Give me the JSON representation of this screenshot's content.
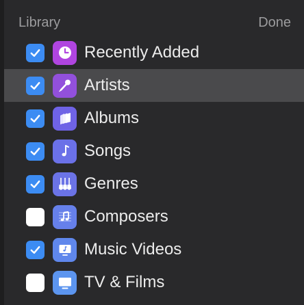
{
  "header": {
    "title": "Library",
    "done_label": "Done"
  },
  "items": [
    {
      "label": "Recently Added",
      "checked": true,
      "icon": "clock-icon",
      "color": "#b045e0"
    },
    {
      "label": "Artists",
      "checked": true,
      "icon": "microphone-icon",
      "color": "#9250dc"
    },
    {
      "label": "Albums",
      "checked": true,
      "icon": "albums-icon",
      "color": "#6f63e6"
    },
    {
      "label": "Songs",
      "checked": true,
      "icon": "music-note-icon",
      "color": "#6b71e8"
    },
    {
      "label": "Genres",
      "checked": true,
      "icon": "guitars-icon",
      "color": "#6b73e6"
    },
    {
      "label": "Composers",
      "checked": false,
      "icon": "sheet-music-icon",
      "color": "#6680ea"
    },
    {
      "label": "Music Videos",
      "checked": true,
      "icon": "music-video-icon",
      "color": "#5f87ec"
    },
    {
      "label": "TV & Films",
      "checked": false,
      "icon": "tv-icon",
      "color": "#5c95ef"
    }
  ],
  "selected_item": "Artists",
  "colors": {
    "background": "#29292b",
    "selection": "#4a4a4c",
    "checkbox_on": "#3c8cf3"
  }
}
